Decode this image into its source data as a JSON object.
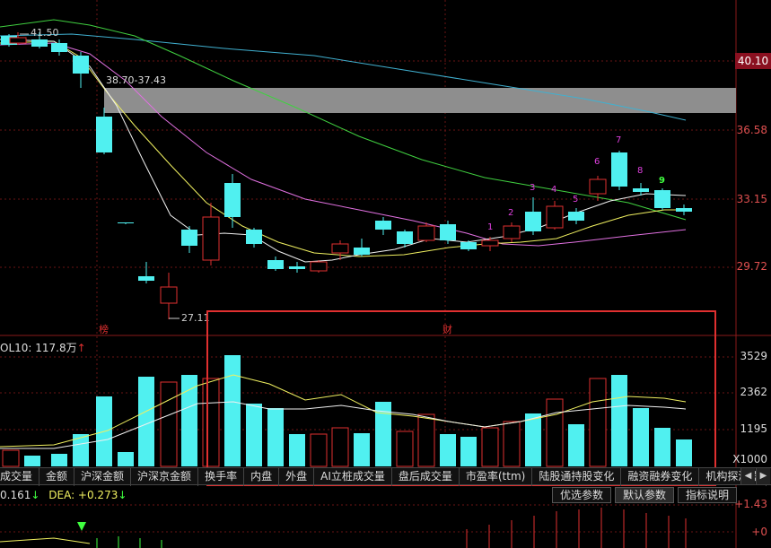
{
  "price_axis": {
    "labels": [
      "36.58",
      "33.15",
      "29.72"
    ],
    "current": "40.10"
  },
  "volume_axis": {
    "labels": [
      "3529",
      "2362",
      "1195"
    ],
    "unit": "X1000"
  },
  "macd_axis": {
    "labels": [
      "1.43",
      "0"
    ]
  },
  "annotations": {
    "high": "41.50",
    "low": "27.11",
    "range": "38.70-37.43",
    "badge_1": "榜",
    "badge_2": "财",
    "seq": [
      "1",
      "2",
      "3",
      "4",
      "5",
      "6",
      "7",
      "8",
      "9"
    ]
  },
  "volume_header": {
    "label": "OL10: 117.8万",
    "arrow": "↑"
  },
  "macd_header": {
    "diff": "0.161",
    "diff_arrow": "↓",
    "dea_label": "DEA: +0.273",
    "dea_arrow": "↓"
  },
  "tabs": [
    "成交量",
    "金额",
    "沪深金额",
    "沪深京金额",
    "换手率",
    "内盘",
    "外盘",
    "AI立桩成交量",
    "盘后成交量",
    "市盈率(ttm)",
    "陆股通持股变化",
    "融资融券变化",
    "机构探测器"
  ],
  "buttons": {
    "optional_params": "优选参数",
    "default_params": "默认参数",
    "indicator_help": "指标说明"
  },
  "colors": {
    "up": "#e03030",
    "down": "#50f0f0",
    "ma_white": "#f0f0f0",
    "ma_yellow": "#f0f060",
    "ma_pink": "#e070e0",
    "ma_green": "#40d040",
    "ma_cyan": "#40b0d0",
    "seq_magenta": "#e040e0",
    "seq_green": "#40ff40",
    "highlight_box": "#e03030"
  }
}
